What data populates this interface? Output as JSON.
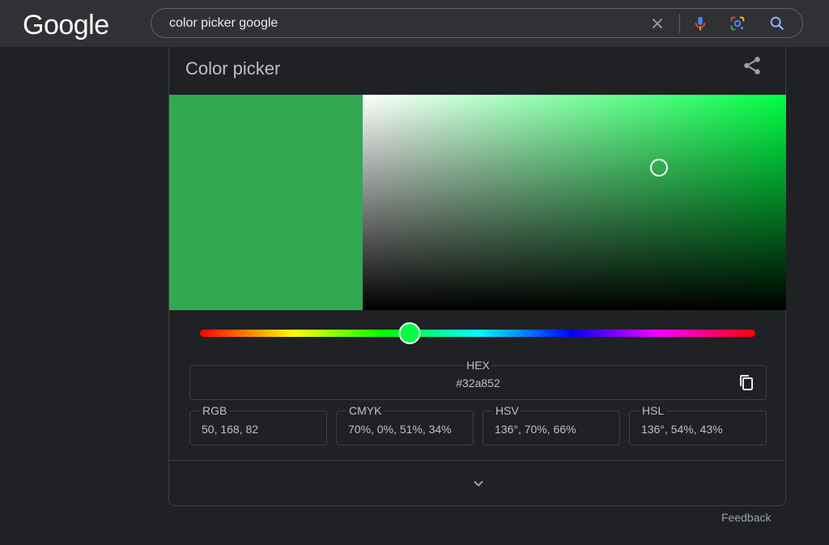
{
  "header": {
    "logo": "Google",
    "search": {
      "value": "color picker google",
      "icons": [
        "clear-icon",
        "microphone-icon",
        "lens-icon",
        "search-icon"
      ]
    }
  },
  "card": {
    "title": "Color picker",
    "share_icon": "share-icon",
    "selected_color": "#32a852",
    "hue_color": "#00ff44",
    "saturation": 0.7,
    "value": 0.66,
    "hue_degrees": 136,
    "hex": {
      "label": "HEX",
      "value": "#32a852"
    },
    "fields": [
      {
        "label": "RGB",
        "value": "50, 168, 82"
      },
      {
        "label": "CMYK",
        "value": "70%, 0%, 51%, 34%"
      },
      {
        "label": "HSV",
        "value": "136°, 70%, 66%"
      },
      {
        "label": "HSL",
        "value": "136°, 54%, 43%"
      }
    ],
    "expand_icon": "chevron-down-icon"
  },
  "footer": {
    "feedback": "Feedback"
  }
}
